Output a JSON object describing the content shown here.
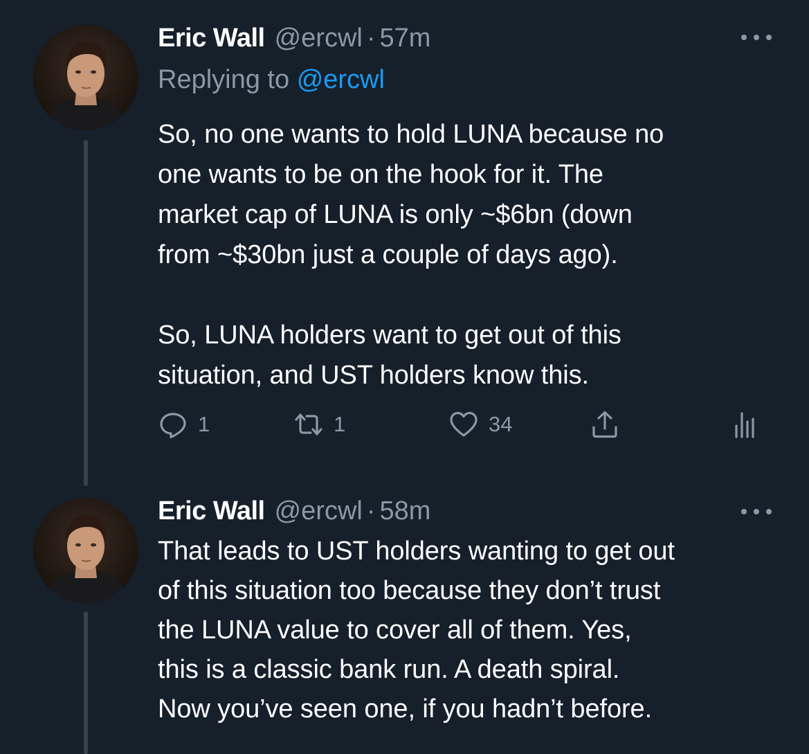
{
  "tweets": [
    {
      "author": {
        "display_name": "Eric Wall",
        "handle": "@ercwl"
      },
      "separator": "·",
      "time": "57m",
      "replying_to": {
        "prefix": "Replying to",
        "handle": "@ercwl"
      },
      "text": "So, no one wants to hold LUNA because no\none wants to be on the hook for it. The\nmarket cap of LUNA is only ~$6bn (down\nfrom ~$30bn just a couple of days ago).\n\nSo, LUNA holders want to get out of this\nsituation, and UST holders know this.",
      "stats": {
        "replies": "1",
        "retweets": "1",
        "likes": "34"
      }
    },
    {
      "author": {
        "display_name": "Eric Wall",
        "handle": "@ercwl"
      },
      "separator": "·",
      "time": "58m",
      "text": "That leads to UST holders wanting to get out\nof this situation too because they don’t trust\nthe LUNA value to cover all of them. Yes,\nthis is a classic bank run. A death spiral.\nNow you’ve seen one, if you hadn’t before."
    }
  ],
  "icons": {
    "reply": "reply-icon",
    "retweet": "retweet-icon",
    "like": "heart-icon",
    "share": "share-icon",
    "analytics": "analytics-icon",
    "more": "more-icon"
  },
  "colors": {
    "background": "#15202b",
    "text": "#ffffff",
    "secondary": "#8b98a5",
    "link": "#1d9bf0",
    "thread_line": "#38444d"
  }
}
